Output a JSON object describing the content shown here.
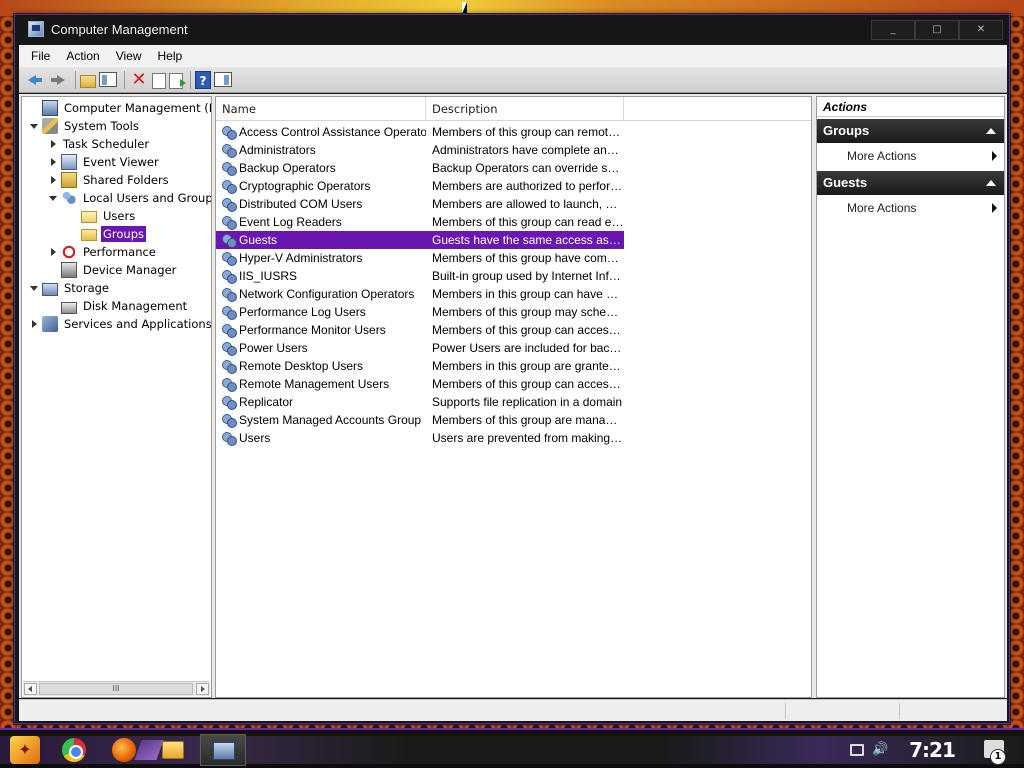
{
  "window": {
    "title": "Computer Management",
    "controls": {
      "minimize": "_",
      "maximize": "□",
      "close": "✕"
    }
  },
  "menu": [
    "File",
    "Action",
    "View",
    "Help"
  ],
  "toolbar": {
    "icons": [
      "back-arrow-icon",
      "forward-arrow-icon",
      "up-folder-icon",
      "show-hide-tree-icon",
      "delete-icon",
      "properties-icon",
      "export-list-icon",
      "help-icon",
      "show-hide-action-pane-icon"
    ]
  },
  "tree": [
    {
      "label": "Computer Management (Local)",
      "depth": 0,
      "expander": "none",
      "icon": "computer"
    },
    {
      "label": "System Tools",
      "depth": 0,
      "expander": "open",
      "icon": "tools"
    },
    {
      "label": "Task Scheduler",
      "depth": 1,
      "expander": "closed",
      "icon": "clock"
    },
    {
      "label": "Event Viewer",
      "depth": 1,
      "expander": "closed",
      "icon": "viewer"
    },
    {
      "label": "Shared Folders",
      "depth": 1,
      "expander": "closed",
      "icon": "shared"
    },
    {
      "label": "Local Users and Groups",
      "depth": 1,
      "expander": "open",
      "icon": "users-grp"
    },
    {
      "label": "Users",
      "depth": 2,
      "expander": "none",
      "icon": "folder"
    },
    {
      "label": "Groups",
      "depth": 2,
      "expander": "none",
      "icon": "folder",
      "selected": true
    },
    {
      "label": "Performance",
      "depth": 1,
      "expander": "closed",
      "icon": "perf"
    },
    {
      "label": "Device Manager",
      "depth": 1,
      "expander": "none",
      "icon": "devmgr"
    },
    {
      "label": "Storage",
      "depth": 0,
      "expander": "open",
      "icon": "storage"
    },
    {
      "label": "Disk Management",
      "depth": 1,
      "expander": "none",
      "icon": "disk"
    },
    {
      "label": "Services and Applications",
      "depth": 0,
      "expander": "closed",
      "icon": "services"
    }
  ],
  "tree_scroll_thumb": "III",
  "list": {
    "columns": [
      "Name",
      "Description"
    ],
    "rows": [
      {
        "name": "Access Control Assistance Operators",
        "desc": "Members of this group can remotely ..."
      },
      {
        "name": "Administrators",
        "desc": "Administrators have complete and un..."
      },
      {
        "name": "Backup Operators",
        "desc": "Backup Operators can override secu..."
      },
      {
        "name": "Cryptographic Operators",
        "desc": "Members are authorized to perform c..."
      },
      {
        "name": "Distributed COM Users",
        "desc": "Members are allowed to launch, activ..."
      },
      {
        "name": "Event Log Readers",
        "desc": "Members of this group can read eve..."
      },
      {
        "name": "Guests",
        "desc": "Guests have the same access as me...",
        "selected": true
      },
      {
        "name": "Hyper-V Administrators",
        "desc": "Members of this group have complet..."
      },
      {
        "name": "IIS_IUSRS",
        "desc": "Built-in group used by Internet Infor..."
      },
      {
        "name": "Network Configuration Operators",
        "desc": "Members in this group can have som..."
      },
      {
        "name": "Performance Log Users",
        "desc": "Members of this group may schedule ..."
      },
      {
        "name": "Performance Monitor Users",
        "desc": "Members of this group can access pe..."
      },
      {
        "name": "Power Users",
        "desc": "Power Users are included for backw..."
      },
      {
        "name": "Remote Desktop Users",
        "desc": "Members in this group are granted th..."
      },
      {
        "name": "Remote Management Users",
        "desc": "Members of this group can access W..."
      },
      {
        "name": "Replicator",
        "desc": "Supports file replication in a domain"
      },
      {
        "name": "System Managed Accounts Group",
        "desc": "Members of this group are managed ..."
      },
      {
        "name": "Users",
        "desc": "Users are prevented from making ac..."
      }
    ]
  },
  "actions": {
    "title": "Actions",
    "sections": [
      {
        "header": "Groups",
        "item": "More Actions"
      },
      {
        "header": "Guests",
        "item": "More Actions"
      }
    ]
  },
  "taskbar": {
    "clock": "7:21 PM",
    "notification_count": "1",
    "icons": [
      "start-icon",
      "chrome-icon",
      "firefox-icon",
      "file-explorer-icon",
      "computer-management-icon",
      "network-icon",
      "volume-icon",
      "notification-icon"
    ]
  }
}
